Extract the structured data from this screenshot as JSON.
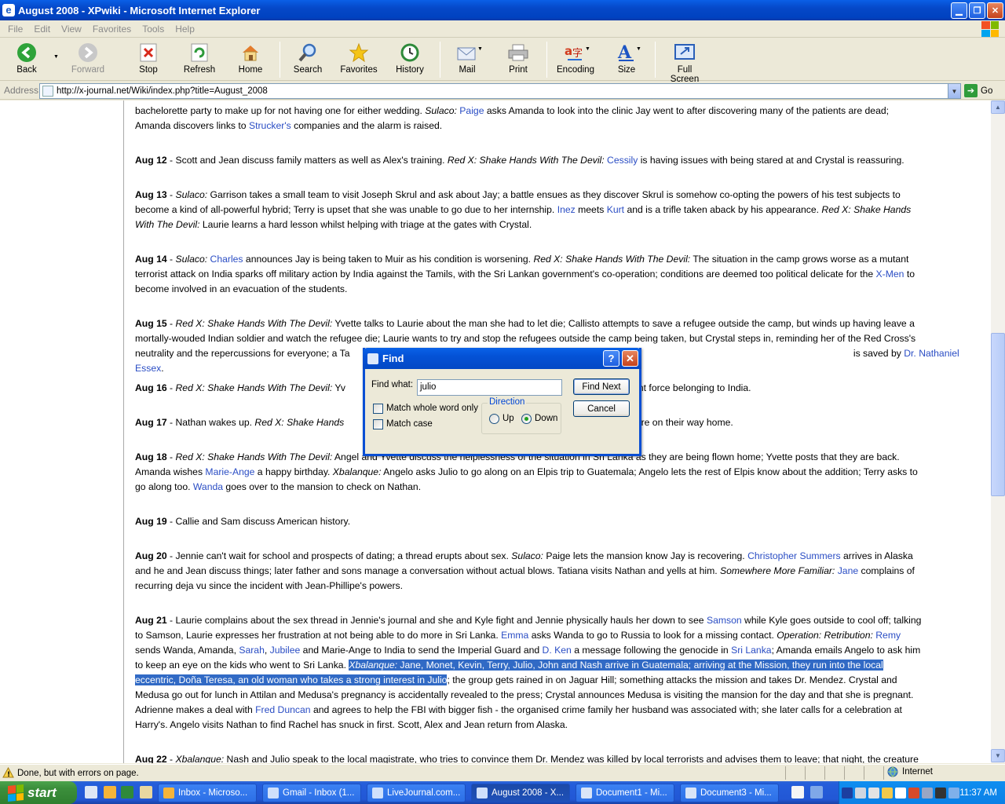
{
  "window": {
    "title": "August 2008 - XPwiki - Microsoft Internet Explorer"
  },
  "menu": [
    "File",
    "Edit",
    "View",
    "Favorites",
    "Tools",
    "Help"
  ],
  "toolbar": {
    "back": "Back",
    "forward": "Forward",
    "stop": "Stop",
    "refresh": "Refresh",
    "home": "Home",
    "search": "Search",
    "favorites": "Favorites",
    "history": "History",
    "mail": "Mail",
    "print": "Print",
    "encoding": "Encoding",
    "size": "Size",
    "fullscreen": "Full Screen"
  },
  "address": {
    "label": "Address",
    "url": "http://x-journal.net/Wiki/index.php?title=August_2008",
    "go": "Go"
  },
  "content": {
    "p0": {
      "a": "bachelorette party to make up for not having one for either wedding. ",
      "b": "Sulaco:",
      "c": " ",
      "l1": "Paige",
      "d": " asks Amanda to look into the clinic Jay went to after discovering many of the patients are dead;",
      "e": "Amanda discovers links to ",
      "l2": "Strucker's",
      "f": " companies and the alarm is raised."
    },
    "p1": {
      "date": "Aug 12",
      "a": " - Scott and Jean discuss family matters as well as Alex's training. ",
      "b": "Red X: Shake Hands With The Devil:",
      "c": " ",
      "l1": "Cessily",
      "d": " is having issues with being stared at and Crystal is reassuring."
    },
    "p2": {
      "date": "Aug 13",
      "a": " - ",
      "b": "Sulaco:",
      "c": " Garrison takes a small team to visit Joseph Skrul and ask about Jay; a battle ensues as they discover Skrul is somehow co-opting the powers of his test subjects to",
      "d": "become a kind of all-powerful hybrid; Terry is upset that she was unable to go due to her internship. ",
      "l1": "Inez",
      "e": " meets ",
      "l2": "Kurt",
      "f": " and is a trifle taken aback by his appearance. ",
      "g": "Red X: Shake Hands",
      "h": "With The Devil:",
      "i": " Laurie learns a hard lesson whilst helping with triage at the gates with Crystal."
    },
    "p3": {
      "date": "Aug 14",
      "a": " - ",
      "b": "Sulaco:",
      "c": " ",
      "l1": "Charles",
      "d": " announces Jay is being taken to Muir as his condition is worsening. ",
      "e": "Red X: Shake Hands With The Devil:",
      "f": " The situation in the camp grows worse as a mutant",
      "g": "terrorist attack on India sparks off military action by India against the Tamils, with the Sri Lankan government's co-operation; conditions are deemed too political delicate for the ",
      "l2": "X-Men",
      "h": " to",
      "i": "become involved in an evacuation of the students."
    },
    "p4": {
      "date": "Aug 15",
      "a": " - ",
      "b": "Red X: Shake Hands With The Devil:",
      "c": " Yvette talks to Laurie about the man she had to let die; Callisto attempts to save a refugee outside the camp, but winds up having leave a",
      "d": "mortally-wouded Indian soldier and watch the refugee die; Laurie wants to try and stop the refugees outside the camp being taken, but Crystal steps in, reminding her of the Red Cross's",
      "e": "neutrality and the repercussions for everyone; a Ta",
      "f": " is saved by ",
      "l1": "Dr. Nathaniel Essex",
      "g": "."
    },
    "p5": {
      "date": "Aug 16",
      "a": " - ",
      "b": "Red X: Shake Hands With The Devil:",
      "c": " Yv",
      "d": "utant force belonging to India."
    },
    "p6": {
      "date": "Aug 17",
      "a": " - Nathan wakes up. ",
      "b": "Red X: Shake Hands",
      "c": "m are on their way home."
    },
    "p7": {
      "date": "Aug 18",
      "a": " - ",
      "b": "Red X: Shake Hands With The Devil:",
      "c": " Angel and Yvette discuss the helplessness of the situation in Sri Lanka as they are being flown home; Yvette posts that they are back.",
      "d": "Amanda wishes ",
      "l1": "Marie-Ange",
      "e": " a happy birthday. ",
      "f": "Xbalanque:",
      "g": " Angelo asks Julio to go along on an Elpis trip to Guatemala; Angelo lets the rest of Elpis know about the addition; Terry asks to",
      "h": "go along too. ",
      "l2": "Wanda",
      "i": " goes over to the mansion to check on Nathan."
    },
    "p8": {
      "date": "Aug 19",
      "a": " - Callie and Sam discuss American history."
    },
    "p9": {
      "date": "Aug 20",
      "a": " - Jennie can't wait for school and prospects of dating; a thread erupts about sex. ",
      "b": "Sulaco:",
      "c": " Paige lets the mansion know Jay is recovering. ",
      "l1": "Christopher Summers",
      "d": " arrives in Alaska",
      "e": "and he and Jean discuss things; later father and sons manage a conversation without actual blows. Tatiana visits Nathan and yells at him. ",
      "f": "Somewhere More Familiar:",
      "g": " ",
      "l2": "Jane",
      "h": " complains of",
      "i": "recurring deja vu since the incident with Jean-Phillipe's powers."
    },
    "p10": {
      "date": "Aug 21",
      "a": " - Laurie complains about the sex thread in Jennie's journal and she and Kyle fight and Jennie physically hauls her down to see ",
      "l1": "Samson",
      "b": " while Kyle goes outside to cool off; talking",
      "c": "to Samson, Laurie expresses her frustration at not being able to do more in Sri Lanka. ",
      "l2": "Emma",
      "d": " asks Wanda to go to Russia to look for a missing contact. ",
      "e": "Operation: Retribution:",
      "f": " ",
      "l3": "Remy",
      "g": "sends Wanda, Amanda, ",
      "l4": "Sarah",
      "h": ", ",
      "l5": "Jubilee",
      "i": " and Marie-Ange to India to send the Imperial Guard and ",
      "l6": "D. Ken",
      "j": " a message following the genocide in ",
      "l7": "Sri Lanka",
      "k": "; Amanda emails Angelo to ask him",
      "m": "to keep an eye on the kids who went to Sri Lanka. ",
      "h1": "Xbalanque:",
      "h2": " Jane, Monet, Kevin, Terry, Julio, John and Nash arrive in Guatemala; arriving at the Mission, they run into the local",
      "h3": "eccentric, Doña Teresa, an old woman who takes a strong interest in Julio",
      "n": "; the group gets rained in on Jaguar Hill; something attacks the mission and takes Dr. Mendez. Crystal and",
      "o": "Medusa go out for lunch in Attilan and Medusa's pregnancy is accidentally revealed to the press; Crystal announces Medusa is visiting the mansion for the day and that she is pregnant.",
      "p": "Adrienne makes a deal with ",
      "l8": "Fred Duncan",
      "q": " and agrees to help the FBI with bigger fish - the organised crime family her husband was associated with; she later calls for a celebration at",
      "r": "Harry's. Angelo visits Nathan to find Rachel has snuck in first. Scott, Alex and Jean return from Alaska."
    },
    "p11": {
      "date": "Aug 22",
      "a": " - ",
      "b": "Xbalanque:",
      "c": " Nash and Julio speak to the local magistrate, who tries to convince them Dr. Mendez was killed by local terrorists and advises them to leave; that night, the creature"
    }
  },
  "find_dialog": {
    "title": "Find",
    "help": "?",
    "find_what_label": "Find what:",
    "find_what_value": "julio",
    "find_next": "Find Next",
    "cancel": "Cancel",
    "match_whole_word": "Match whole word only",
    "match_case": "Match case",
    "direction": "Direction",
    "up": "Up",
    "down": "Down",
    "direction_selected": "Down"
  },
  "status": {
    "message": "Done, but with errors on page.",
    "zone": "Internet"
  },
  "taskbar": {
    "start": "start",
    "tasks": [
      "Inbox - Microso...",
      "Gmail - Inbox (1...",
      "LiveJournal.com...",
      "August 2008 - X...",
      "Document1 - Mi...",
      "Document3 - Mi..."
    ],
    "clock": "11:37 AM"
  },
  "colors": {
    "link": "#2a4dc4",
    "highlight": "#316ac5",
    "title_blue": "#0548c8"
  }
}
